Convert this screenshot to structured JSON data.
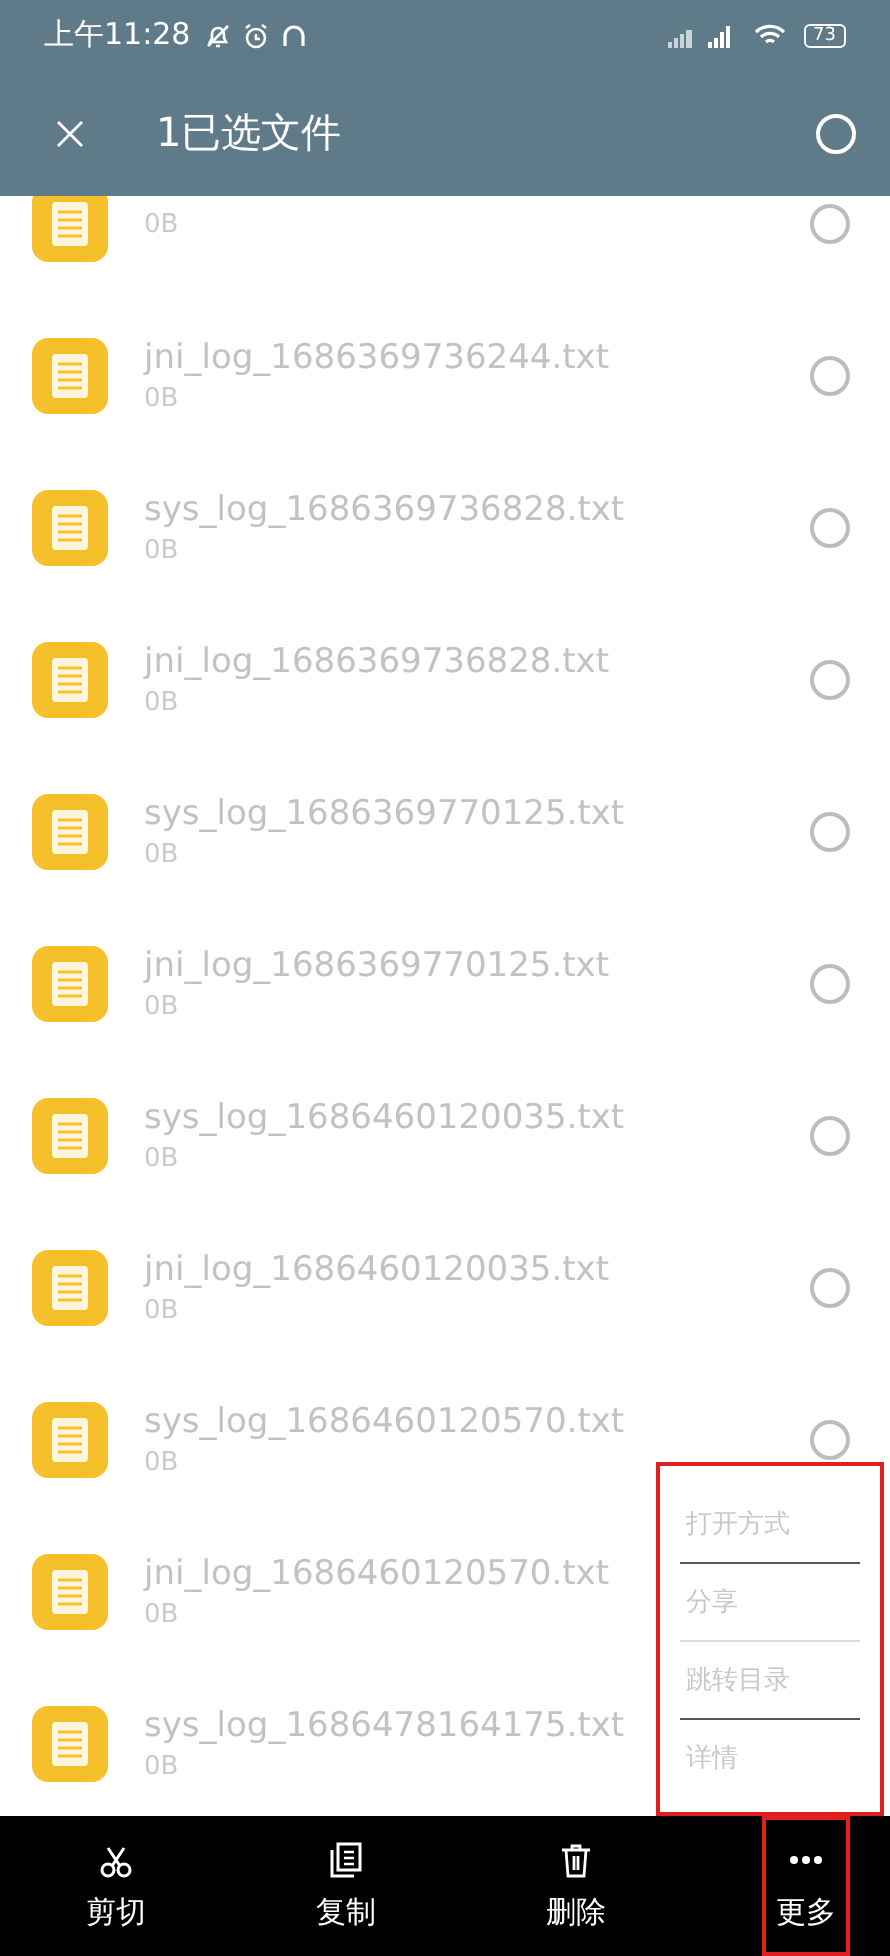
{
  "status_bar": {
    "time": "上午11:28",
    "battery": "73"
  },
  "header": {
    "title": "1已选文件",
    "select_all": {
      "checked": false
    }
  },
  "files": [
    {
      "size": "0B",
      "selected": false
    },
    {
      "name": "jni_log_1686369736244.txt",
      "size": "0B",
      "selected": false
    },
    {
      "name": "sys_log_1686369736828.txt",
      "size": "0B",
      "selected": false
    },
    {
      "name": "jni_log_1686369736828.txt",
      "size": "0B",
      "selected": false
    },
    {
      "name": "sys_log_1686369770125.txt",
      "size": "0B",
      "selected": false
    },
    {
      "name": "jni_log_1686369770125.txt",
      "size": "0B",
      "selected": false
    },
    {
      "name": "sys_log_1686460120035.txt",
      "size": "0B",
      "selected": false
    },
    {
      "name": "jni_log_1686460120035.txt",
      "size": "0B",
      "selected": false
    },
    {
      "name": "sys_log_1686460120570.txt",
      "size": "0B",
      "selected": false
    },
    {
      "name": "jni_log_1686460120570.txt",
      "size": "0B"
    },
    {
      "name": "sys_log_1686478164175.txt",
      "size": "0B"
    }
  ],
  "more_menu": {
    "highlighted": true,
    "items": [
      "打开方式",
      "分享",
      "跳转目录",
      "详情"
    ]
  },
  "actions": [
    {
      "kind": "cut",
      "label": "剪切",
      "highlighted": false
    },
    {
      "kind": "copy",
      "label": "复制",
      "highlighted": false
    },
    {
      "kind": "delete",
      "label": "删除",
      "highlighted": false
    },
    {
      "kind": "more",
      "label": "更多",
      "highlighted": true
    }
  ]
}
